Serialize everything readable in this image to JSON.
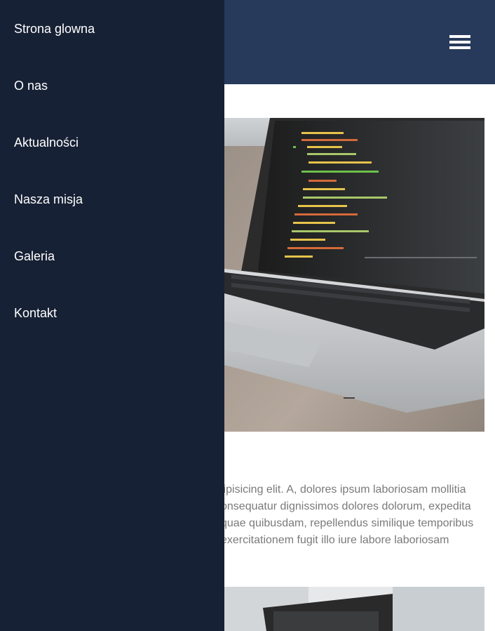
{
  "nav": {
    "items": [
      {
        "label": "Strona glowna"
      },
      {
        "label": "O nas"
      },
      {
        "label": "Aktualności"
      },
      {
        "label": "Nasza misja"
      },
      {
        "label": "Galeria"
      },
      {
        "label": "Kontakt"
      }
    ]
  },
  "header": {
    "menu_icon": "hamburger-menu-icon"
  },
  "article": {
    "lines": [
      "lipisicing elit. A, dolores ipsum laboriosam mollitia",
      "onsequatur dignissimos dolores dolorum, expedita",
      "quae quibusdam, repellendus similique temporibus",
      "exercitationem fugit illo iure labore laboriosam"
    ]
  },
  "colors": {
    "header_bg": "#273a5c",
    "sidebar_bg": "#172135",
    "text_gray": "#7a7a7a"
  }
}
